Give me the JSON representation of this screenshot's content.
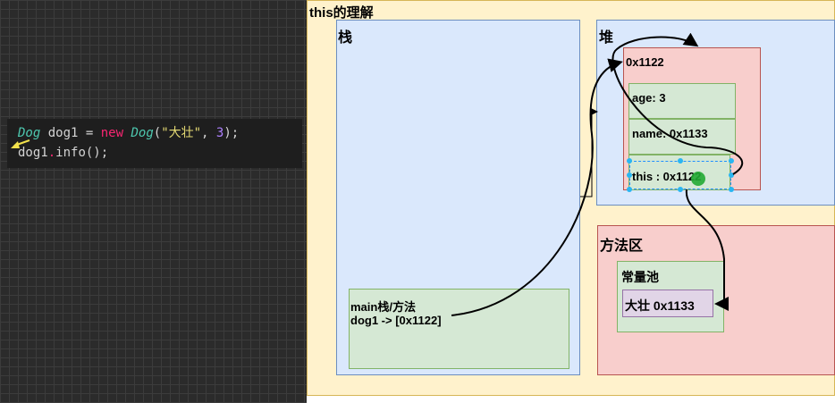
{
  "code": {
    "line1": {
      "type": "Dog",
      "var": " dog1 = ",
      "new": "new",
      "ctor": " Dog",
      "open": "(",
      "str": "\"大壮\"",
      "sep": ", ",
      "num": "3",
      "close": ");"
    },
    "line2": {
      "text": "dog1",
      "dot": ".",
      "rest": "info();"
    }
  },
  "diagram": {
    "title": "this的理解",
    "stack_label": "栈",
    "heap_label": "堆",
    "object_address": "0x1122",
    "field_age": "age: 3",
    "field_name": "name: 0x1133",
    "field_this": "this : 0x1122",
    "method_area_label": "方法区",
    "constant_pool_label": "常量池",
    "string_constant": "大壮 0x1133",
    "main_frame_line1": "main栈/方法",
    "main_frame_line2": "dog1 -> [0x1122]"
  },
  "colors": {
    "stack_fill": "#dae8fc",
    "object_fill": "#f8cecc",
    "field_fill": "#d5e8d4",
    "string_fill": "#e1d5e7",
    "outer_fill": "#fff2cc"
  }
}
